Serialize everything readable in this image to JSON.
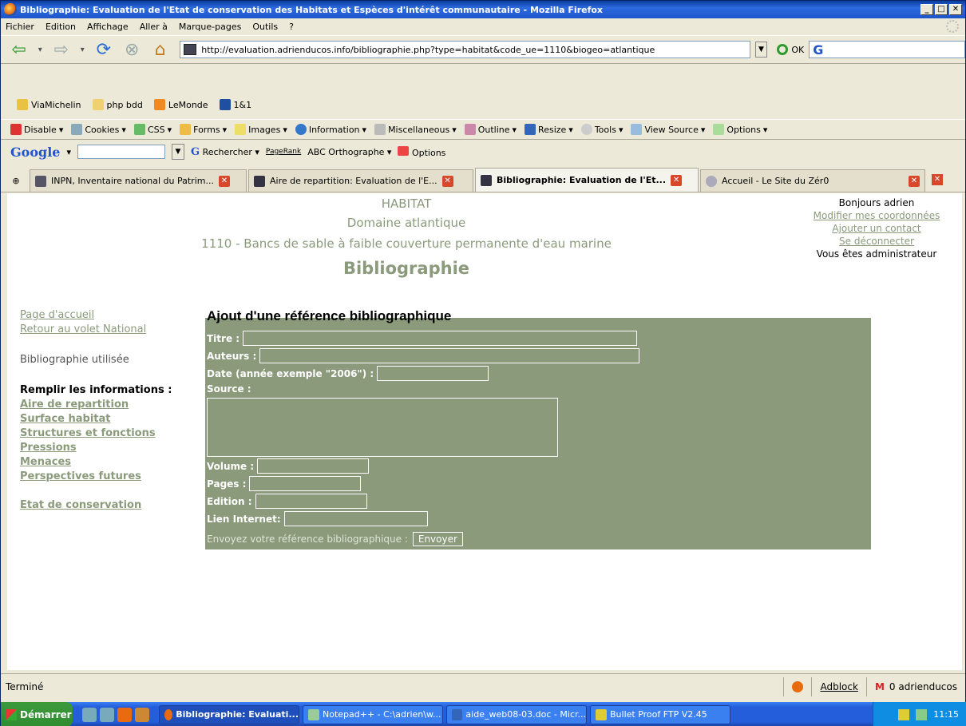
{
  "window": {
    "title": "Bibliographie: Evaluation de l'Etat de conservation des Habitats et Espèces d'intérêt communautaire - Mozilla Firefox"
  },
  "menu": [
    "Fichier",
    "Edition",
    "Affichage",
    "Aller à",
    "Marque-pages",
    "Outils",
    "?"
  ],
  "nav": {
    "url": "http://evaluation.adrienducos.info/bibliographie.php?type=habitat&code_ue=1110&biogeo=atlantique",
    "go_label": "OK"
  },
  "bookmarks": [
    "ViaMichelin",
    "php bdd",
    "LeMonde",
    "1&1"
  ],
  "devtoolbar": [
    "Disable",
    "Cookies",
    "CSS",
    "Forms",
    "Images",
    "Information",
    "Miscellaneous",
    "Outline",
    "Resize",
    "Tools",
    "View Source",
    "Options"
  ],
  "googlebar": {
    "logo": "Google",
    "search": "Rechercher",
    "pagerank": "PageRank",
    "spell": "Orthographe",
    "options": "Options"
  },
  "tabs": [
    {
      "label": "INPN, Inventaire national du Patrim..."
    },
    {
      "label": "Aire de repartition: Evaluation de l'E..."
    },
    {
      "label": "Bibliographie: Evaluation de l'Et..."
    },
    {
      "label": "Accueil - Le Site du Zér0"
    }
  ],
  "header": {
    "type": "HABITAT",
    "domain": "Domaine atlantique",
    "habitat": "1110 - Bancs de sable à faible couverture permanente d'eau marine",
    "section": "Bibliographie"
  },
  "user": {
    "greeting": "Bonjours adrien",
    "edit": "Modifier mes coordonnées",
    "contact": "Ajouter un contact",
    "logout": "Se déconnecter",
    "role": "Vous êtes administrateur"
  },
  "sidebar": {
    "home": "Page d'accueil",
    "national": "Retour au volet National",
    "biblio": "Bibliographie utilisée",
    "fill_label": "Remplir les informations :",
    "items": [
      "Aire de repartition",
      "Surface habitat",
      "Structures et fonctions",
      "Pressions",
      "Menaces",
      "Perspectives futures"
    ],
    "status": "Etat de conservation"
  },
  "form": {
    "title": "Ajout d'une référence bibliographique",
    "titre": "Titre :",
    "auteurs": "Auteurs :",
    "date": "Date (année exemple \"2006\") :",
    "source": "Source :",
    "volume": "Volume :",
    "pages": "Pages :",
    "edition": "Edition :",
    "lien": "Lien Internet:",
    "send_text": "Envoyez votre référence bibliographique :",
    "send_button": "Envoyer"
  },
  "status": {
    "text": "Terminé",
    "adblock": "Adblock",
    "mail": "0 adrienducos"
  },
  "taskbar": {
    "start": "Démarrer",
    "tasks": [
      "Bibliographie: Evaluati...",
      "Notepad++ - C:\\adrien\\w...",
      "aide_web08-03.doc - Micr...",
      "Bullet Proof FTP V2.45"
    ],
    "clock": "11:15"
  }
}
